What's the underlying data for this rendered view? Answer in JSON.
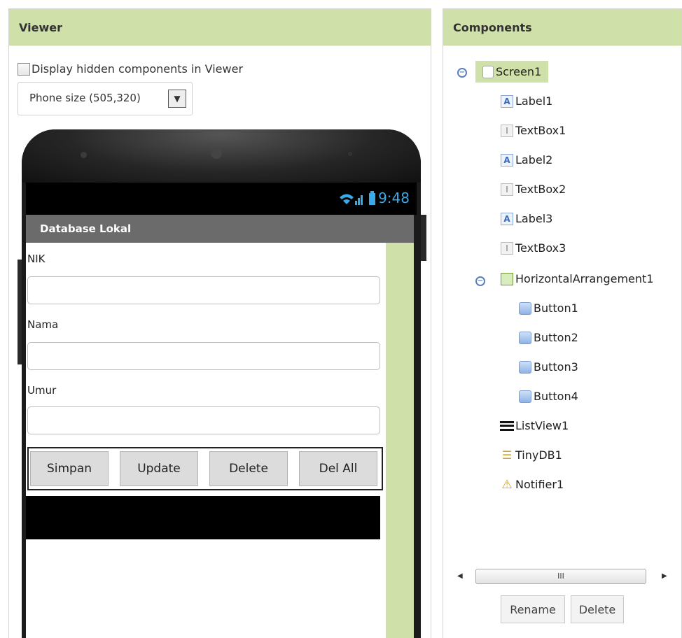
{
  "viewer": {
    "title": "Viewer",
    "hidden_toggle_label": "Display hidden components in Viewer",
    "size_select_value": "Phone size (505,320)"
  },
  "phone": {
    "status_time": "9:48",
    "app_title": "Database Lokal",
    "fields": [
      {
        "label": "NIK",
        "value": ""
      },
      {
        "label": "Nama",
        "value": ""
      },
      {
        "label": "Umur",
        "value": ""
      }
    ],
    "buttons": [
      "Simpan",
      "Update",
      "Delete",
      "Del All"
    ]
  },
  "components": {
    "title": "Components",
    "tree": [
      {
        "name": "Screen1",
        "icon": "screen-icon"
      },
      {
        "name": "Label1",
        "icon": "label-icon"
      },
      {
        "name": "TextBox1",
        "icon": "textbox-icon"
      },
      {
        "name": "Label2",
        "icon": "label-icon"
      },
      {
        "name": "TextBox2",
        "icon": "textbox-icon"
      },
      {
        "name": "Label3",
        "icon": "label-icon"
      },
      {
        "name": "TextBox3",
        "icon": "textbox-icon"
      },
      {
        "name": "HorizontalArrangement1",
        "icon": "horizontal-arrangement-icon"
      },
      {
        "name": "Button1",
        "icon": "button-icon"
      },
      {
        "name": "Button2",
        "icon": "button-icon"
      },
      {
        "name": "Button3",
        "icon": "button-icon"
      },
      {
        "name": "Button4",
        "icon": "button-icon"
      },
      {
        "name": "ListView1",
        "icon": "listview-icon"
      },
      {
        "name": "TinyDB1",
        "icon": "tinydb-icon"
      },
      {
        "name": "Notifier1",
        "icon": "notifier-icon"
      }
    ],
    "scroll_thumb_label": "III",
    "rename_label": "Rename",
    "delete_label": "Delete"
  },
  "colors": {
    "header_bg": "#cfe0a8",
    "phone_body": "#1b1b1b",
    "status_icons": "#39a9e8",
    "title_bar": "#6b6b6b"
  }
}
